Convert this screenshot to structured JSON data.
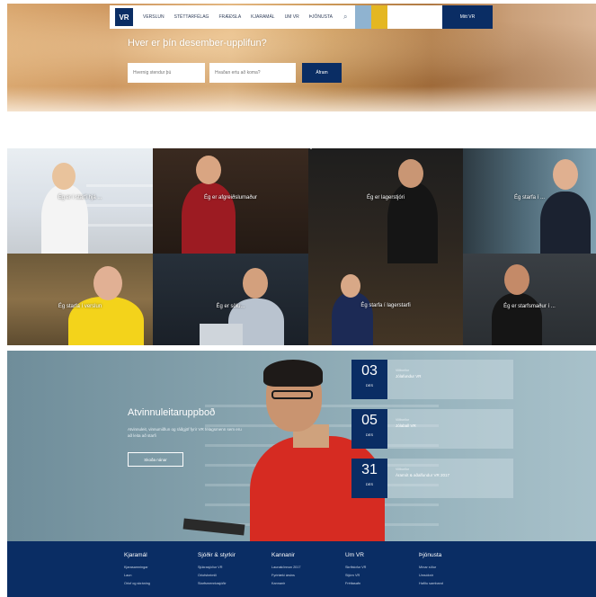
{
  "nav": {
    "logo": "VR",
    "items": [
      "VERSLUN",
      "STÉTTARFÉLAG",
      "FRÆÐSLA",
      "KJARAMÁL",
      "UM VR",
      "ÞJÓNUSTA"
    ],
    "search_icon": "search-icon",
    "cta": "Mitt VR",
    "accent_colors": [
      "#8fb3d0",
      "#e4b722"
    ]
  },
  "hero": {
    "title": "Hver er þín desember-upplifun?",
    "input1_placeholder": "Hvernig stendur þú",
    "input2_placeholder": "Hvaðan ertu að koma?",
    "button": "Áfram"
  },
  "tiles": [
    {
      "caption": "Ég er í starfi hjá ..."
    },
    {
      "caption": "Ég er afgreiðslumaður"
    },
    {
      "caption": "Ég er lagerstjóri"
    },
    {
      "caption": "Ég starfa í ..."
    },
    {
      "caption": "Ég starfa í verslun"
    },
    {
      "caption": "Ég er sölu..."
    },
    {
      "caption": "Ég starfa í lagerstarfi"
    },
    {
      "caption": "Ég er starfsmaður í ..."
    }
  ],
  "promo": {
    "title": "Atvinnuleitaruppboð",
    "text": "Atvinnuleit, vinnumiðlun og ráðgjöf fyrir VR félagsmenn sem eru að leita að starfi",
    "button": "Skoða nánar",
    "events": [
      {
        "day": "03",
        "month": "DES",
        "kind": "Viðburður",
        "name": "Jólafundur VR"
      },
      {
        "day": "05",
        "month": "DES",
        "kind": "Viðburður",
        "name": "Jólaball VR"
      },
      {
        "day": "31",
        "month": "DES",
        "kind": "Viðburður",
        "name": "Áramót & aðalfundur VR 2017"
      }
    ]
  },
  "footer": {
    "columns": [
      {
        "heading": "Kjaramál",
        "links": [
          "Kjarasamningar",
          "Laun",
          "Orlof og skráning"
        ]
      },
      {
        "heading": "Sjóðir & styrkir",
        "links": [
          "Sjúkrasjóður VR",
          "Orlofsheimili",
          "Starfsmenntasjóðir"
        ]
      },
      {
        "heading": "Kannanir",
        "links": [
          "Launakönnun 2017",
          "Fyrirtæki ársins",
          "Kannanir"
        ]
      },
      {
        "heading": "Um VR",
        "links": [
          "Skrifstofur VR",
          "Stjórn VR",
          "Fréttasafn"
        ]
      },
      {
        "heading": "Þjónusta",
        "links": [
          "Mínar síður",
          "Umsóknir",
          "Hafðu samband"
        ]
      }
    ]
  }
}
